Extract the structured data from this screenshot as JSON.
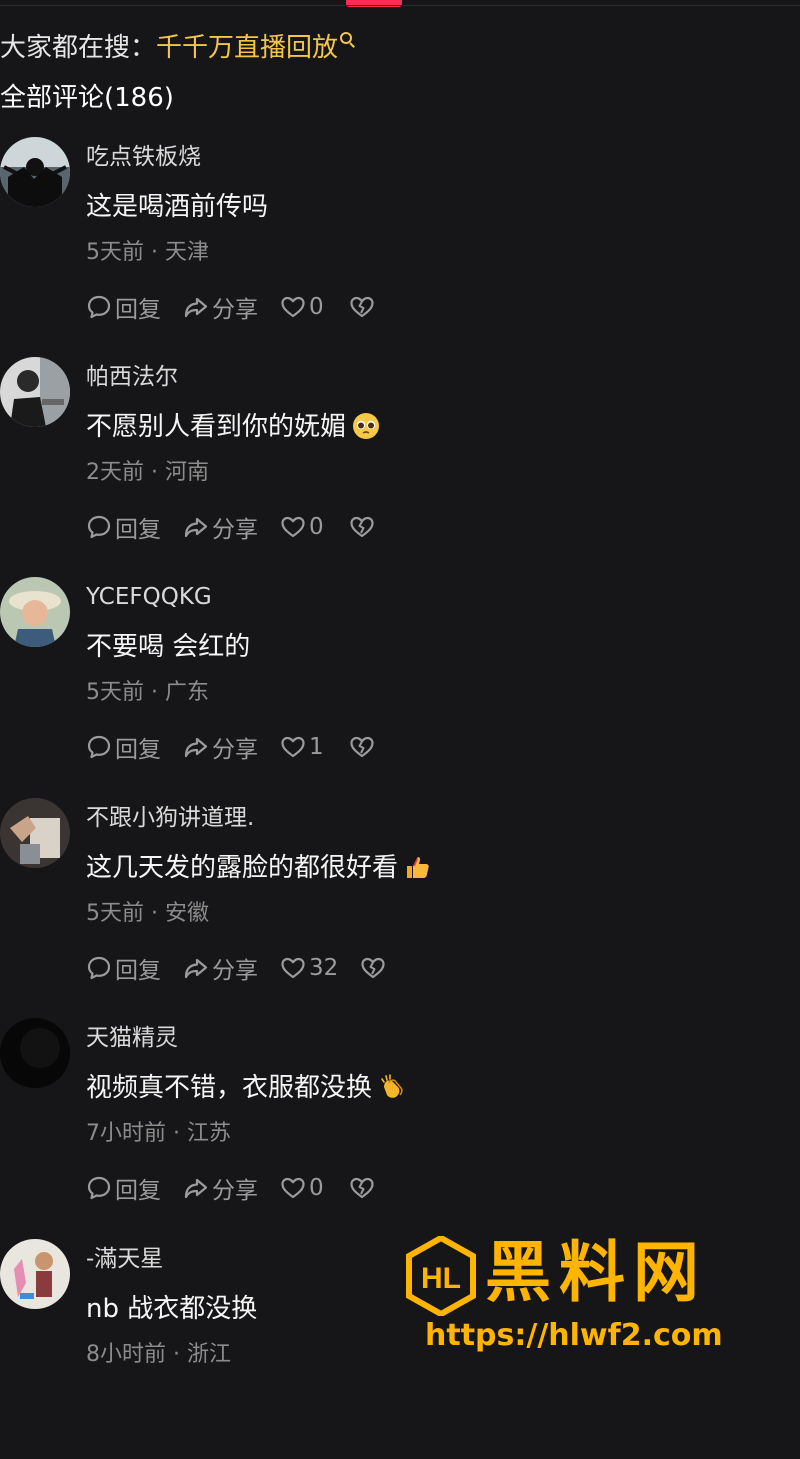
{
  "header": {
    "search_prefix": "大家都在搜：",
    "search_keyword": "千千万直播回放",
    "comment_count": "全部评论(186)"
  },
  "actions": {
    "reply": "回复",
    "share": "分享"
  },
  "comments": [
    {
      "username": "吃点铁板烧",
      "text": "这是喝酒前传吗",
      "emoji": "",
      "time": "5天前",
      "location": "天津",
      "likes": "0"
    },
    {
      "username": "帕西法尔",
      "text": "不愿别人看到你的妩媚",
      "emoji": "pleading-face",
      "time": "2天前",
      "location": "河南",
      "likes": "0"
    },
    {
      "username": "YCEFQQKG",
      "text": "不要喝 会红的",
      "emoji": "",
      "time": "5天前",
      "location": "广东",
      "likes": "1"
    },
    {
      "username": "不跟小狗讲道理.",
      "text": "这几天发的露脸的都很好看",
      "emoji": "thumbs-up",
      "time": "5天前",
      "location": "安徽",
      "likes": "32"
    },
    {
      "username": "天猫精灵",
      "text": "视频真不错，衣服都没换",
      "emoji": "clapping-hands",
      "time": "7小时前",
      "location": "江苏",
      "likes": "0"
    },
    {
      "username": "-滿天星",
      "text": "nb 战衣都没换",
      "emoji": "",
      "time": "8小时前",
      "location": "浙江",
      "likes": ""
    }
  ],
  "watermark": {
    "logo_text": "HL",
    "title": "黑料网",
    "url": "https://hlwf2.com"
  },
  "colors": {
    "background": "#161618",
    "accent": "#fe2c55",
    "keyword": "#f3c64a",
    "watermark": "#ffb400"
  }
}
